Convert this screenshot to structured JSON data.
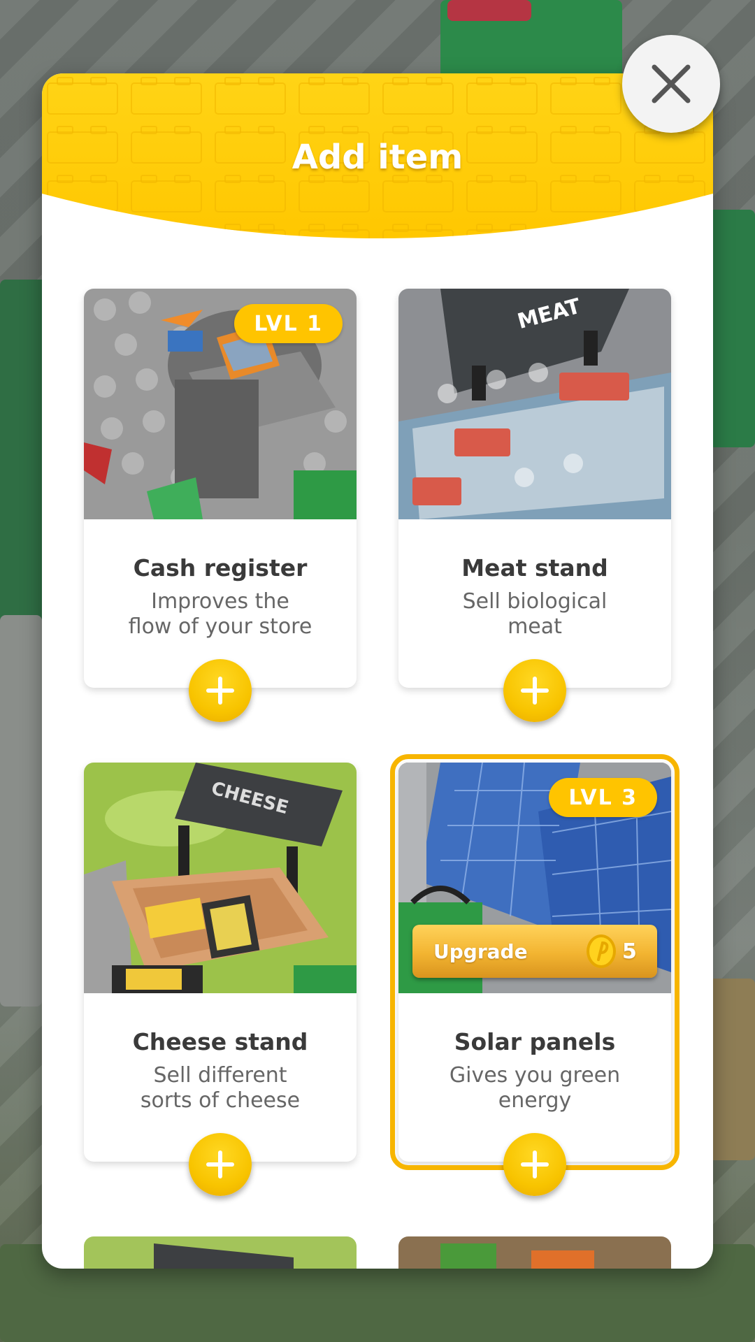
{
  "modal": {
    "title": "Add item",
    "close_icon": "close-icon",
    "accent_color": "#FFC400"
  },
  "items": [
    {
      "name": "Cash register",
      "description_line1": "Improves the",
      "description_line2": "flow of your store",
      "level_badge": "LVL 1",
      "add_icon": "plus-icon",
      "image": "cash-register-image"
    },
    {
      "name": "Meat stand",
      "description_line1": "Sell biological",
      "description_line2": "meat",
      "sign_text": "MEAT",
      "add_icon": "plus-icon",
      "image": "meat-stand-image"
    },
    {
      "name": "Cheese stand",
      "description_line1": "Sell different",
      "description_line2": "sorts of cheese",
      "sign_text": "CHEESE",
      "add_icon": "plus-icon",
      "image": "cheese-stand-image"
    },
    {
      "name": "Solar panels",
      "description_line1": "Gives you green",
      "description_line2": "energy",
      "level_badge": "LVL 3",
      "upgrade_label": "Upgrade",
      "upgrade_cost": "5",
      "currency_icon": "coin-icon",
      "selected": true,
      "add_icon": "plus-icon",
      "image": "solar-panels-image"
    }
  ]
}
